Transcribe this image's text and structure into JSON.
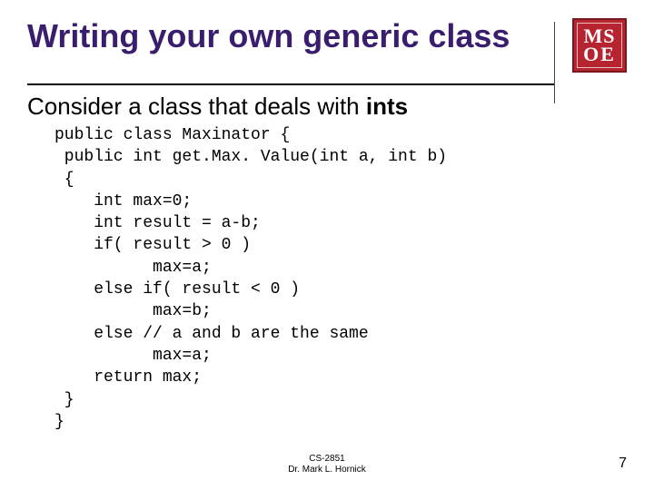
{
  "logo": {
    "top": "MS",
    "bottom": "OE"
  },
  "title": "Writing your own generic class",
  "subtitle_prefix": "Consider a class that deals with ",
  "subtitle_emph": "ints",
  "code": "public class Maxinator {\n public int get.Max. Value(int a, int b)\n {\n    int max=0;\n    int result = a-b;\n    if( result > 0 )\n          max=a;\n    else if( result < 0 )\n          max=b;\n    else // a and b are the same\n          max=a;\n    return max;\n }\n}",
  "footer": {
    "course": "CS-2851",
    "author": "Dr. Mark L. Hornick"
  },
  "page_number": "7"
}
